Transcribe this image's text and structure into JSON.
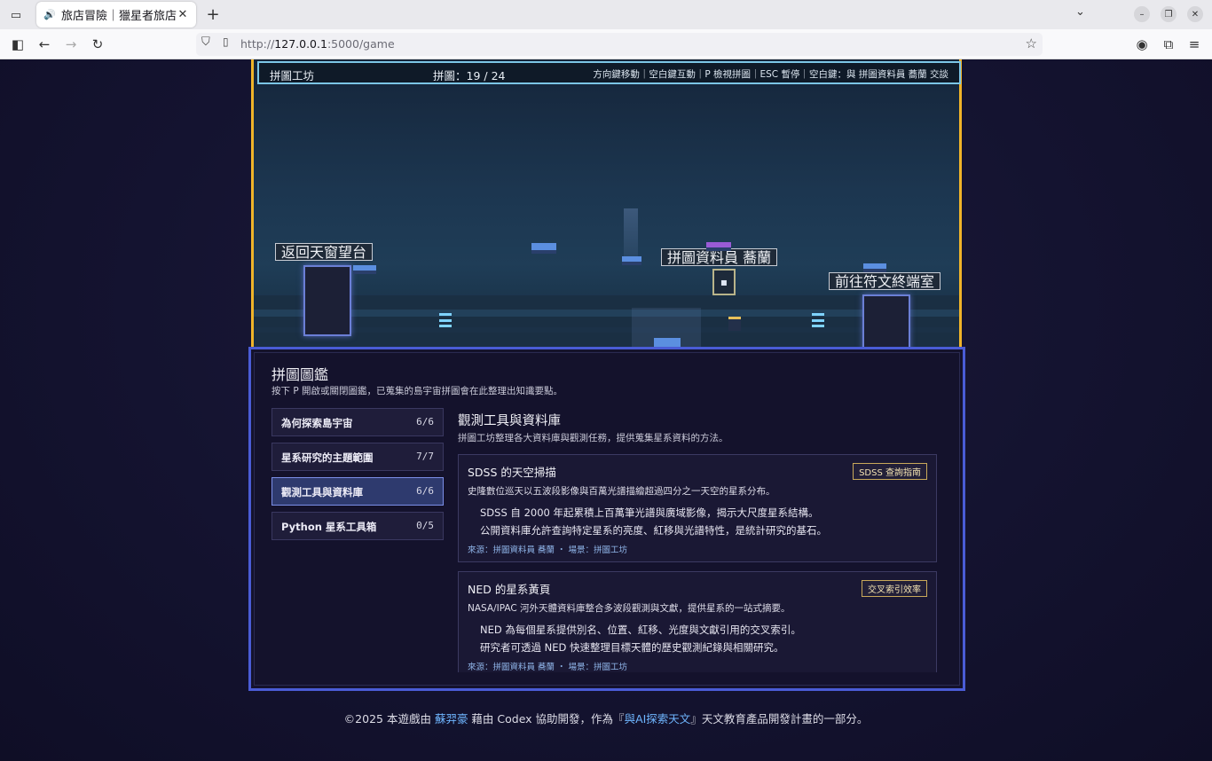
{
  "browser": {
    "tab_title": "旅店冒險｜獵星者旅店—",
    "url_prefix": "http://",
    "url_host": "127.0.0.1",
    "url_rest": ":5000/game"
  },
  "hud": {
    "location": "拼圖工坊",
    "progress": "拼圖：19 / 24",
    "controls": "方向鍵移動｜空白鍵互動｜P 檢視拼圖｜ESC 暫停｜空白鍵：與 拼圖資料員 蕎蘭 交談"
  },
  "scene": {
    "sign_left": "返回天窗望台",
    "sign_npc": "拼圖資料員 蕎蘭",
    "sign_right": "前往符文終端室",
    "npc_glyph": "▪"
  },
  "panel": {
    "title": "拼圖圖鑑",
    "subtitle": "按下 P 開啟或關閉圖鑑，已蒐集的島宇宙拼圖會在此整理出知識要點。",
    "categories": [
      {
        "label": "為何探索島宇宙",
        "count": "6/6"
      },
      {
        "label": "星系研究的主題範圍",
        "count": "7/7"
      },
      {
        "label": "觀測工具與資料庫",
        "count": "6/6"
      },
      {
        "label": "Python 星系工具箱",
        "count": "0/5"
      }
    ],
    "section_title": "觀測工具與資料庫",
    "section_desc": "拼圖工坊整理各大資料庫與觀測任務，提供蒐集星系資料的方法。",
    "cards": [
      {
        "title": "SDSS 的天空掃描",
        "tag": "SDSS 查詢指南",
        "summary": "史隆數位巡天以五波段影像與百萬光譜描繪超過四分之一天空的星系分布。",
        "detail1": "SDSS 自 2000 年起累積上百萬筆光譜與廣域影像，揭示大尺度星系結構。",
        "detail2": "公開資料庫允許查詢特定星系的亮度、紅移與光譜特性，是統計研究的基石。",
        "source": "來源：拼圖資料員 蕎蘭 ・ 場景：拼圖工坊"
      },
      {
        "title": "NED 的星系黃頁",
        "tag": "交叉索引效率",
        "summary": "NASA/IPAC 河外天體資料庫整合多波段觀測與文獻，提供星系的一站式摘要。",
        "detail1": "NED 為每個星系提供別名、位置、紅移、光度與文獻引用的交叉索引。",
        "detail2": "研究者可透過 NED 快速整理目標天體的歷史觀測紀錄與相關研究。",
        "source": "來源：拼圖資料員 蕎蘭 ・ 場景：拼圖工坊"
      }
    ]
  },
  "footer": {
    "pre": "©2025 本遊戲由 ",
    "author": "蘇羿豪",
    "mid": " 藉由 Codex 協助開發，作為『",
    "project": "與AI探索天文",
    "post": "』天文教育產品開發計畫的一部分。"
  }
}
